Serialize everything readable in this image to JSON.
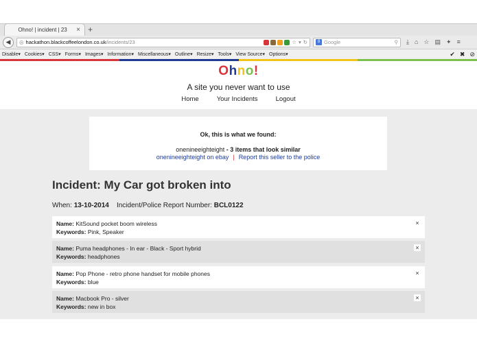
{
  "browser": {
    "tab_title": "Ohno! | incident | 23",
    "tab_close": "×",
    "new_tab": "+",
    "url_domain": "hackathon.blackcoffeelondon.co.uk",
    "url_prefix": "",
    "url_path": "/incidents/23",
    "search_placeholder": "Google",
    "search_badge": "8"
  },
  "devbar": {
    "items": [
      "Disable",
      "Cookies",
      "CSS",
      "Forms",
      "Images",
      "Information",
      "Miscellaneous",
      "Outline",
      "Resize",
      "Tools",
      "View Source",
      "Options"
    ],
    "right": [
      "✔",
      "✖",
      "⊘"
    ]
  },
  "colors": {
    "stripe": [
      "#d8343b",
      "#1f3a93",
      "#f0c419",
      "#7bbf4c"
    ],
    "logo": [
      "#d8343b",
      "#1f3a93",
      "#f0c419",
      "#7bbf4c",
      "#d8343b"
    ]
  },
  "site": {
    "logo_letters": [
      "O",
      "h",
      "n",
      "o",
      "!"
    ],
    "tagline": "A site you never want to use",
    "nav": [
      "Home",
      "Your Incidents",
      "Logout"
    ]
  },
  "found": {
    "heading": "Ok, this is what we found:",
    "seller": "onenineeighteight",
    "summary": " - 3 items that look similar",
    "link_ebay": "onenineeighteight on ebay",
    "separator": "|",
    "link_report": "Report this seller to the police"
  },
  "incident": {
    "title": "Incident: My Car got broken into",
    "when_label": "When:",
    "when_value": "13-10-2014",
    "report_label": "Incident/Police Report Number:",
    "report_value": "BCL0122"
  },
  "items_labels": {
    "name": "Name:",
    "keywords": "Keywords:",
    "remove": "×"
  },
  "items": [
    {
      "name": "KitSound pocket boom wireless",
      "keywords": "Pink, Speaker"
    },
    {
      "name": "Puma headphones - In ear - Black - Sport hybrid",
      "keywords": "headphones"
    },
    {
      "name": "Pop Phone - retro phone handset for mobile phones",
      "keywords": "blue"
    },
    {
      "name": "Macbook Pro - silver",
      "keywords": "new in box"
    }
  ]
}
